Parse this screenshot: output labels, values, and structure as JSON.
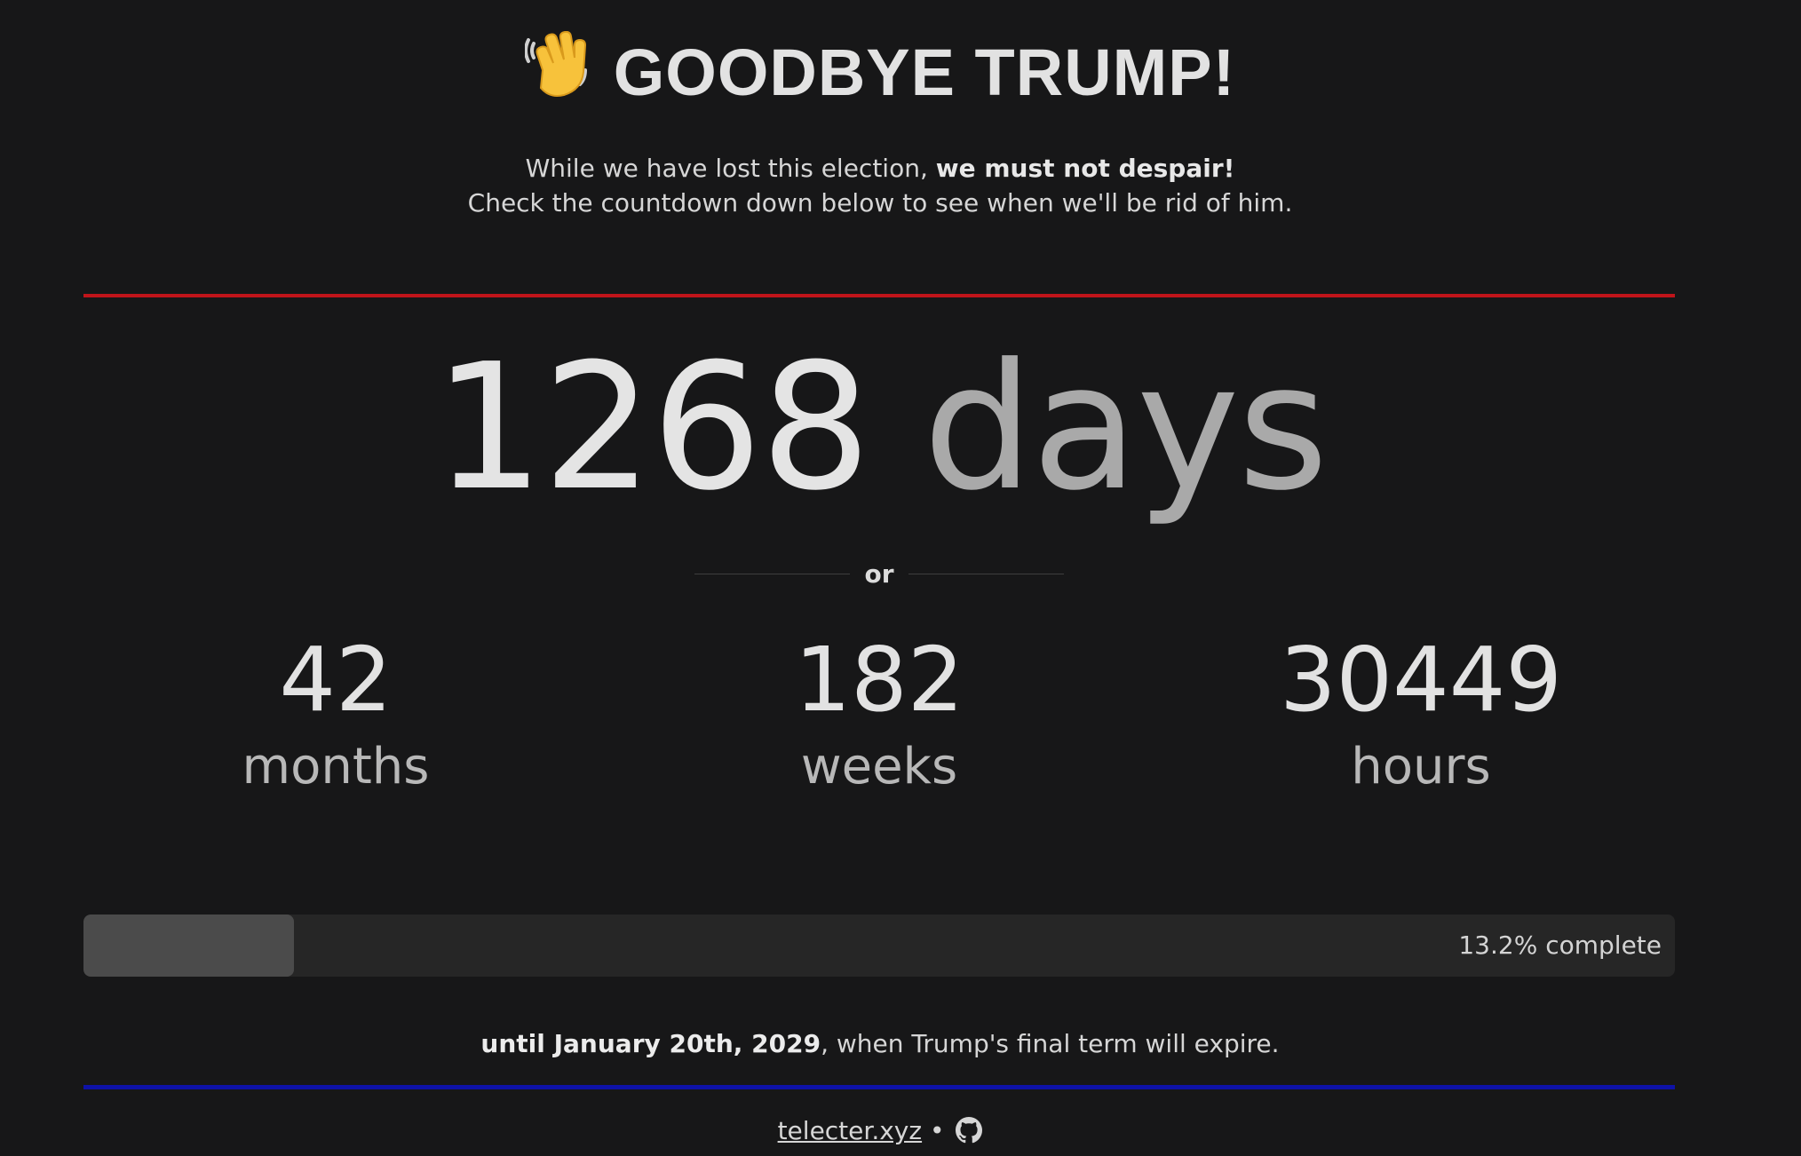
{
  "header": {
    "title": "GOODBYE TRUMP!",
    "wave_icon": "waving-hand-icon"
  },
  "intro": {
    "line1_prefix": "While we have lost this election, ",
    "line1_bold": "we must not despair!",
    "line2": "Check the countdown down below to see when we'll be rid of him."
  },
  "countdown": {
    "days_value": "1268",
    "days_unit": "days",
    "or_text": "or",
    "months_value": "42",
    "months_label": "months",
    "weeks_value": "182",
    "weeks_label": "weeks",
    "hours_value": "30449",
    "hours_label": "hours"
  },
  "progress": {
    "percent": 13.2,
    "label": "13.2% complete"
  },
  "until": {
    "bold": "until January 20th, 2029",
    "rest": ", when Trump's final term will expire."
  },
  "footer": {
    "link_text": "telecter.xyz",
    "separator": "•",
    "github_icon": "github-icon"
  },
  "colors": {
    "background": "#171718",
    "top_rule": "#c0141a",
    "bottom_rule": "#0e12a8",
    "progress_track": "#262626",
    "progress_fill": "#4b4b4b"
  }
}
